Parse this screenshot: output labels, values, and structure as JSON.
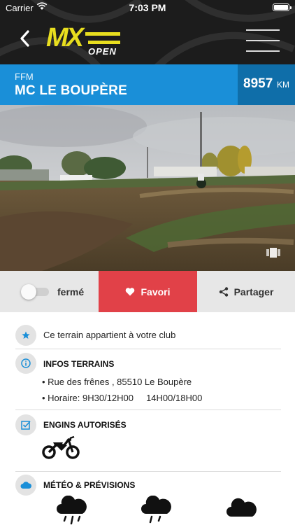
{
  "status_bar": {
    "carrier": "Carrier",
    "time": "7:03 PM"
  },
  "header": {
    "logo_text": "MX OPEN",
    "logo_main": "MX",
    "logo_sub": "OPEN",
    "back_icon": "chevron-left-icon",
    "menu_icon": "hamburger-icon"
  },
  "club": {
    "federation": "FFM",
    "name": "MC LE BOUPÈRE",
    "distance_value": "8957",
    "distance_unit": "KM"
  },
  "actions": {
    "toggle_label": "fermé",
    "toggle_on": false,
    "favorite_label": "Favori",
    "share_label": "Partager"
  },
  "info": {
    "club_notice": "Ce terrain appartient à votre club",
    "terrain_title": "INFOS TERRAINS",
    "address": "• Rue des frênes , 85510 Le Boupère",
    "hours": "• Horaire: 9H30/12H00     14H00/18H00",
    "engines_title": "ENGINS AUTORISÉS",
    "engines": [
      "motocross-bike-icon"
    ],
    "weather_title": "MÉTÉO & PRÉVISIONS",
    "forecast_icons": [
      "rain-cloud-icon",
      "rain-cloud-icon",
      "cloud-icon"
    ]
  },
  "colors": {
    "header": "#1c1c1c",
    "banner": "#1a8fd8",
    "banner_dark": "#0f6ea9",
    "favorite": "#e14148",
    "logo_yellow": "#e8de1f",
    "icon_blue": "#1a8fd8"
  }
}
